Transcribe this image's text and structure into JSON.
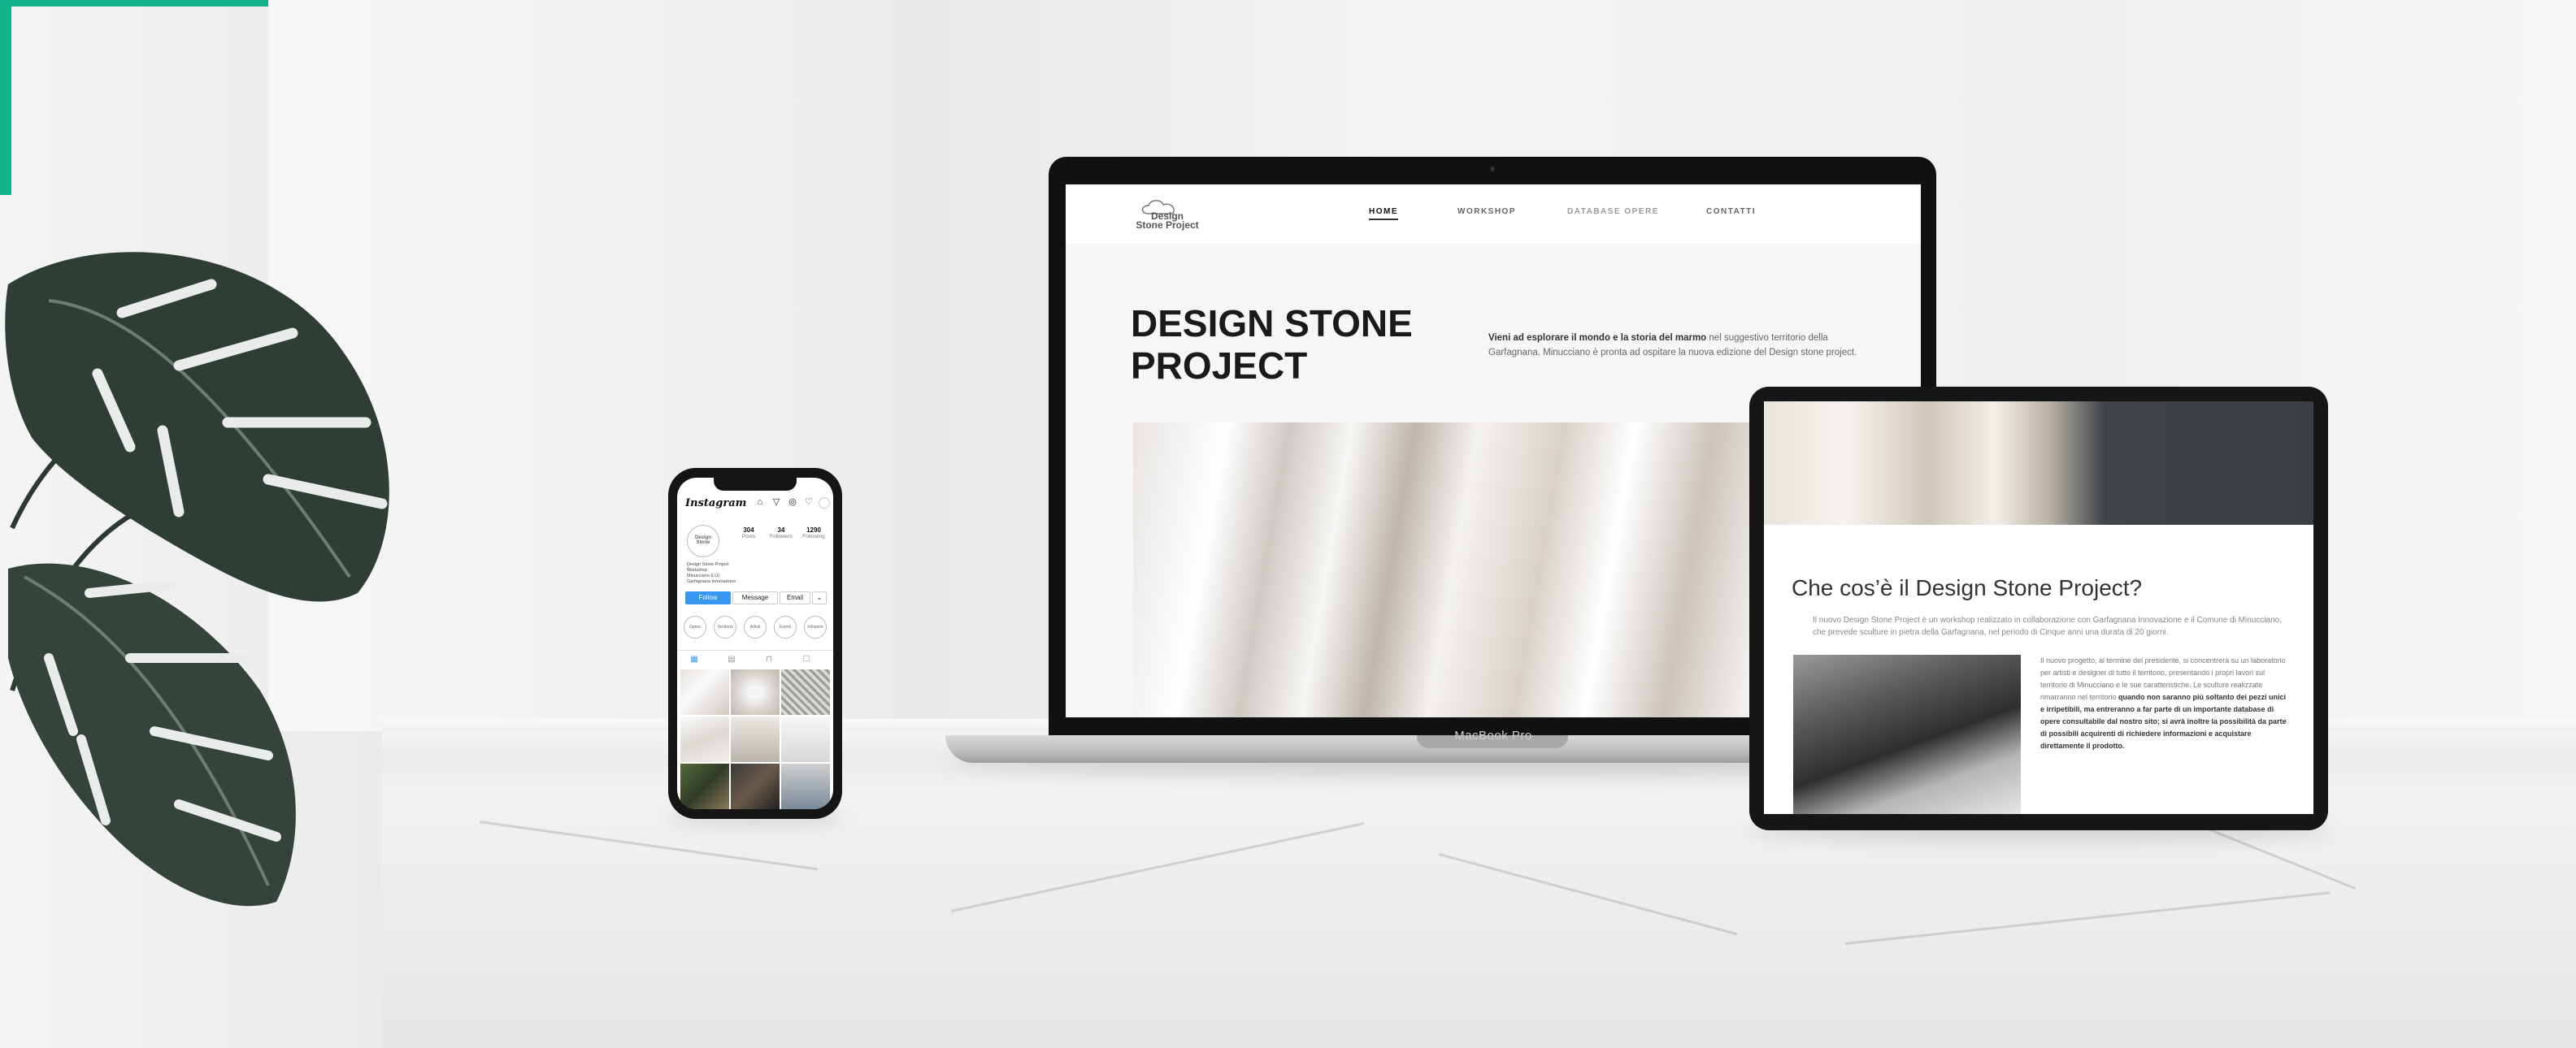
{
  "colors": {
    "accent": "#12b28a",
    "instagram_blue": "#3897f0"
  },
  "laptop": {
    "brand": "MacBook Pro",
    "site": {
      "logo_line1": "Design",
      "logo_line2": "Stone Project",
      "nav": [
        {
          "label": "HOME",
          "active": true
        },
        {
          "label": "WORKSHOP",
          "active": false
        },
        {
          "label": "DATABASE OPERE",
          "active": false
        },
        {
          "label": "CONTATTI",
          "active": false
        }
      ],
      "hero_title": "DESIGN STONE PROJECT",
      "hero_desc_lead": "Vieni ad esplorare il mondo e la storia del marmo",
      "hero_desc_rest": " nel suggestivo territorio della Garfagnana. Minucciano è pronta ad ospitare la nuova edizione del Design stone project."
    }
  },
  "tablet": {
    "heading": "Che cos’è il Design Stone Project?",
    "lead": "Il nuovo Design Stone Project è un workshop realizzato in collaborazione con Garfagnana Innovazione e il Comune di Minucciano, che prevede sculture in pietra della Garfagnana, nel periodo di Cinque anni una durata di 20 giorni.",
    "body_plain": "Il nuovo progetto, al termine del presidente, si concentrerà su un laboratorio per artisti e designer di tutto il territorio, presentando i propri lavori sul territorio di Minucciano e le sue caratteristiche. Le sculture realizzate rimarranno nel territorio ",
    "body_bold": "quando non saranno più soltanto dei pezzi unici e irripetibili, ma entreranno a far parte di un importante database di opere consultabile dal nostro sito; si avrà inoltre la possibilità da parte di possibili acquirenti di richiedere informazioni e acquistare direttamente il prodotto."
  },
  "phone": {
    "app": "Instagram",
    "stats": [
      {
        "value": "304",
        "label": "Posts"
      },
      {
        "value": "34",
        "label": "Followers"
      },
      {
        "value": "1290",
        "label": "Following"
      }
    ],
    "avatar_text": "Design Stone",
    "bio": [
      "Design Stone Project",
      "Workshop",
      "Minucciano (LU)",
      "Garfagnana Innovazione"
    ],
    "buttons": {
      "follow": "Follow",
      "message": "Message",
      "email": "Email"
    },
    "highlights": [
      "Opere",
      "Territorio",
      "Artisti",
      "Eventi",
      "Infopoint"
    ]
  }
}
